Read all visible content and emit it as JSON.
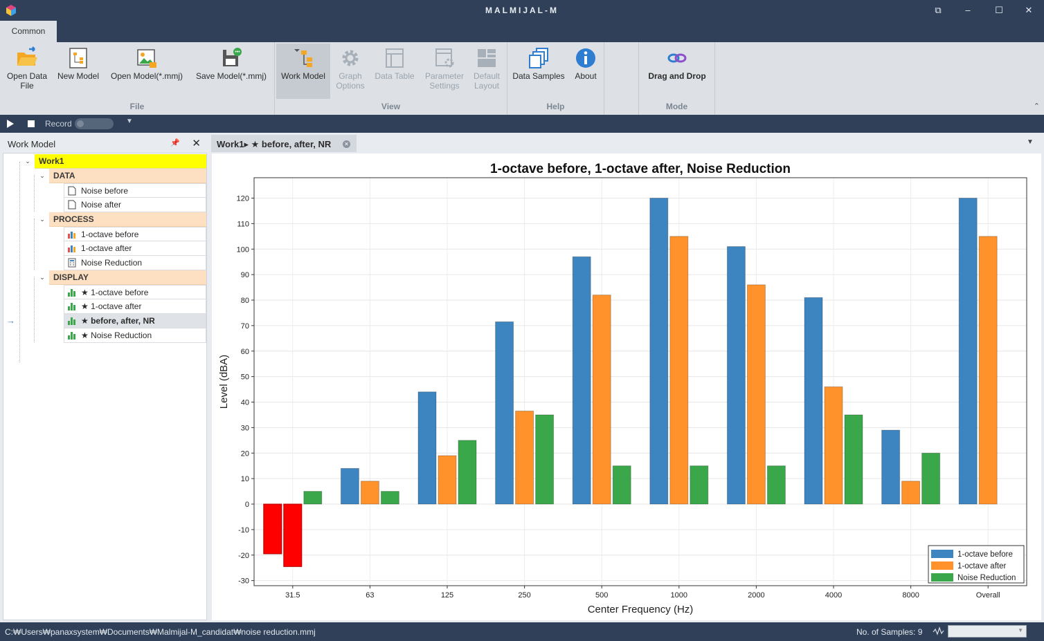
{
  "app": {
    "title": "MALMIJAL-M"
  },
  "window": {
    "restore": "⧉",
    "minimize": "–",
    "maximize": "☐",
    "close": "✕"
  },
  "ribbon": {
    "tab": "Common",
    "groups": {
      "file": "File",
      "view": "View",
      "help": "Help",
      "mode": "Mode"
    },
    "buttons": {
      "open_data_line1": "Open Data",
      "open_data_line2": "File",
      "new_model": "New Model",
      "open_model": "Open Model(*.mmj)",
      "save_model": "Save Model(*.mmj)",
      "work_model": "Work Model",
      "graph_options_line1": "Graph",
      "graph_options_line2": "Options",
      "data_table": "Data Table",
      "parameter_settings_line1": "Parameter",
      "parameter_settings_line2": "Settings",
      "default_layout_line1": "Default",
      "default_layout_line2": "Layout",
      "data_samples": "Data Samples",
      "about": "About",
      "drag_and_drop": "Drag and Drop"
    },
    "collapse": "⌃"
  },
  "record": {
    "label": "Record",
    "caret": "▼"
  },
  "work_model": {
    "title": "Work Model",
    "pin": "📌",
    "close": "✕",
    "root": "Work1",
    "sections": [
      {
        "label": "DATA",
        "items": [
          "Noise before",
          "Noise after"
        ]
      },
      {
        "label": "PROCESS",
        "items": [
          "1-octave before",
          "1-octave after",
          "Noise Reduction"
        ]
      },
      {
        "label": "DISPLAY",
        "items": [
          "★ 1-octave before",
          "★ 1-octave after",
          "★ before, after, NR",
          "★ Noise Reduction"
        ]
      }
    ],
    "twisty": "⌄",
    "pointer": "→"
  },
  "doc_tab": {
    "label": "Work1▸ ★ before, after, NR",
    "close": "✕",
    "dropdown": "▼"
  },
  "status": {
    "path": "C:₩Users₩panaxsystem₩Documents₩Malmijal-M_candidat₩noise reduction.mmj",
    "samples": "No. of Samples: 9",
    "combo_caret": "▼"
  },
  "colors": {
    "before": "#3d85c0",
    "after": "#ff922b",
    "nr": "#3aa84a",
    "negative": "#ff0000",
    "selected_root": "#ffff00",
    "section": "#fde0c2"
  },
  "chart_data": {
    "type": "bar",
    "title": "1-octave before, 1-octave after, Noise Reduction",
    "xlabel": "Center Frequency (Hz)",
    "ylabel": "Level (dBA)",
    "ylim": [
      -32,
      128
    ],
    "yticks": [
      -30,
      -20,
      -10,
      0,
      10,
      20,
      30,
      40,
      50,
      60,
      70,
      80,
      90,
      100,
      110,
      120
    ],
    "categories": [
      "31.5",
      "63",
      "125",
      "250",
      "500",
      "1000",
      "2000",
      "4000",
      "8000",
      "Overall"
    ],
    "series": [
      {
        "name": "1-octave before",
        "color": "#3d85c0",
        "values": [
          -19.5,
          14,
          44,
          71.5,
          97,
          120,
          101,
          81,
          29,
          120
        ]
      },
      {
        "name": "1-octave after",
        "color": "#ff922b",
        "values": [
          -24.5,
          9,
          19,
          36.5,
          82,
          105,
          86,
          46,
          9,
          105
        ]
      },
      {
        "name": "Noise Reduction",
        "color": "#3aa84a",
        "values": [
          5,
          5,
          25,
          35,
          15,
          15,
          15,
          35,
          20,
          null
        ]
      }
    ],
    "negative_color": "#ff0000",
    "grid": true,
    "legend": "bottom-right"
  }
}
